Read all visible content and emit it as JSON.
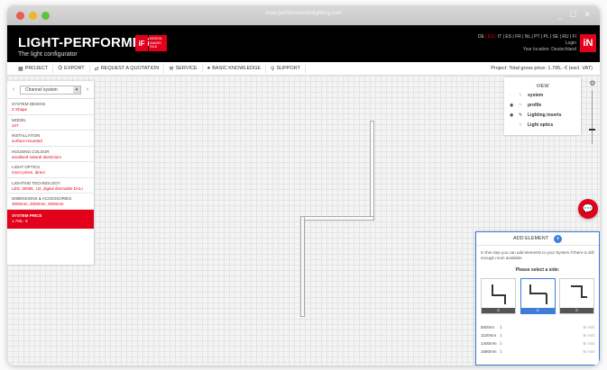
{
  "browser": {
    "url": "www.performanceinlighting.com",
    "controls": [
      "_",
      "☐",
      "✕"
    ]
  },
  "header": {
    "brand_title": "LIGHT-PERFORMER",
    "brand_reg": "®",
    "brand_subtitle": "The light configurator",
    "if_award": {
      "logo": "iF",
      "text": "DESIGN AWARD 2018"
    },
    "languages_before": "DE",
    "language_active": "| EN |",
    "languages_after": "IT | ES | FR | NL | PT | PL | SE | RU | FI",
    "login_label": "Login",
    "location_label": "Your location: Deutschland",
    "logo_in": "iN"
  },
  "menu": {
    "items": [
      {
        "icon": "▦",
        "label": "PROJECT"
      },
      {
        "icon": "⛭",
        "label": "EXPORT"
      },
      {
        "icon": "⇄",
        "label": "REQUEST A QUOTATION"
      },
      {
        "icon": "⚒",
        "label": "SERVICE"
      },
      {
        "icon": "●",
        "label": "BASIC KNOWLEDGE"
      },
      {
        "icon": "⚲",
        "label": "SUPPORT"
      }
    ],
    "project_price": "Project: Total gross price: 1.795,- € (excl. VAT)"
  },
  "sidebar": {
    "nav_prev": "‹",
    "nav_next": "›",
    "selector_value": "Channel system",
    "selector_caret": "▾",
    "rows": [
      {
        "label": "SYSTEM DESIGN",
        "value": "Z Shape"
      },
      {
        "label": "MODEL",
        "value": "107"
      },
      {
        "label": "INSTALLATION",
        "value": "surface-mounted"
      },
      {
        "label": "HOUSING COLOUR",
        "value": "anodised natural aluminium"
      },
      {
        "label": "LIGHT OPTICS",
        "value": "micro prism, direct"
      },
      {
        "label": "LIGHTING TECHNOLOGY",
        "value": "LED, 3000K, U2, digital dimmable DALI"
      },
      {
        "label": "DIMENSIONS & ACCESSORIES",
        "value": "3000mm, 2000mm, 3000mm"
      }
    ],
    "price_label": "SYSTEM PRICE",
    "price_value": "1.795,- €"
  },
  "view_panel": {
    "title": "VIEW",
    "rows": [
      {
        "eye": "◦",
        "pen": "✎",
        "label": "system"
      },
      {
        "eye": "◉",
        "pen": "✎",
        "label": "profile"
      },
      {
        "eye": "◉",
        "pen": "✎",
        "label": "Lighting inserts"
      },
      {
        "eye": "◦",
        "pen": "✎",
        "label": "Light optics"
      }
    ]
  },
  "zoom": {
    "icon": "⚙",
    "level": 0.72
  },
  "chat": {
    "icon": "💬"
  },
  "add_panel": {
    "title": "ADD ELEMENT",
    "plus": "+",
    "info": "In this step you can add elements to your System if there is still enough room available.",
    "select_side": "Please select a side:",
    "options": [
      {
        "shape": "left",
        "bar_icon": "⊙"
      },
      {
        "shape": "middle",
        "bar_icon": "⊙"
      },
      {
        "shape": "right",
        "bar_icon": "⊙"
      }
    ],
    "lengths": [
      {
        "length": "560mm",
        "icon": "⇂",
        "add": "⊕ Add"
      },
      {
        "length": "1120mm",
        "icon": "⇂",
        "add": "⊕ Add"
      },
      {
        "length": "1400mm",
        "icon": "⇂",
        "add": "⊕ Add"
      },
      {
        "length": "1680mm",
        "icon": "⇂",
        "add": "⊕ Add"
      }
    ]
  },
  "colors": {
    "accent_red": "#e3001b",
    "accent_blue": "#3d7ed9",
    "header_bg": "#000000"
  }
}
